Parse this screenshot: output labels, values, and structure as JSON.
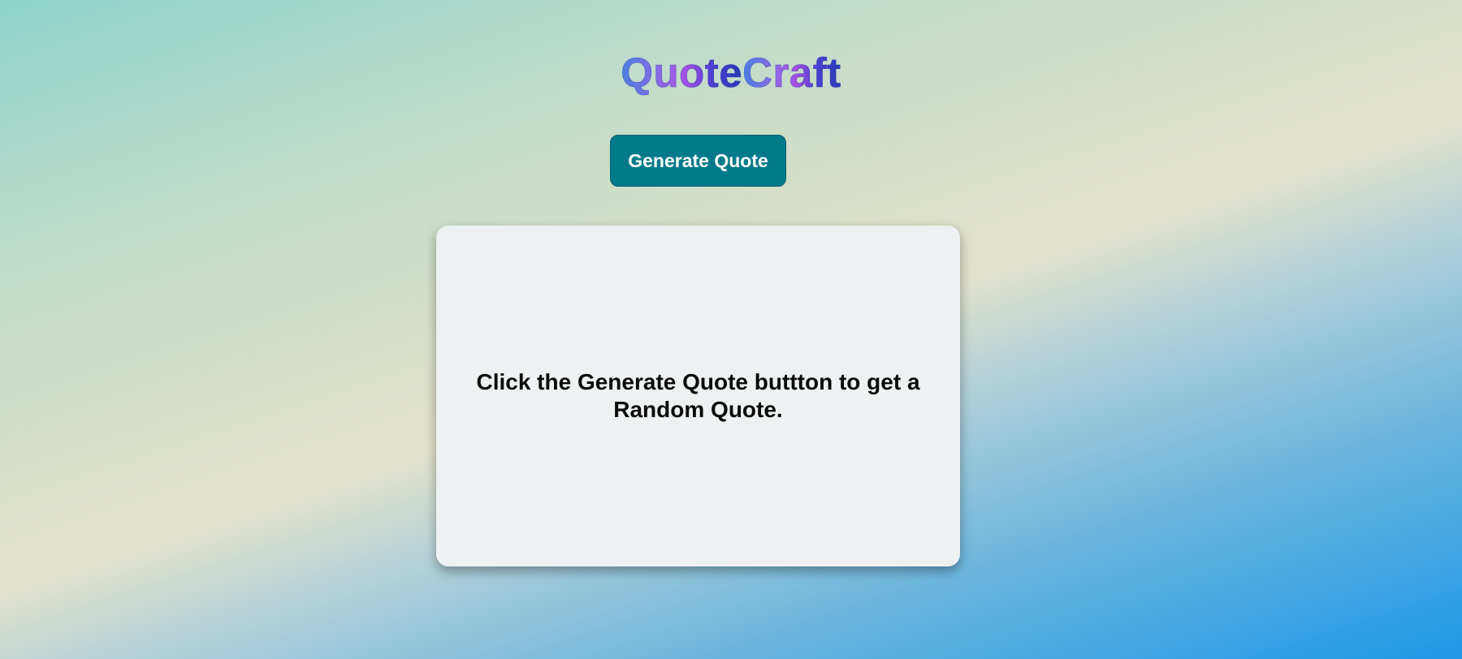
{
  "app": {
    "title_part1": "Quote",
    "title_part2": "Craft"
  },
  "toolbar": {
    "generate_label": "Generate Quote"
  },
  "quote_card": {
    "text": "Click the Generate Quote buttton to get a Random Quote."
  },
  "colors": {
    "button_bg": "#027a8a",
    "card_bg": "#eef1f2",
    "title_gradient_start": "#4a7fe0",
    "title_gradient_mid": "#a24ee0",
    "title_gradient_end": "#283ab4"
  }
}
